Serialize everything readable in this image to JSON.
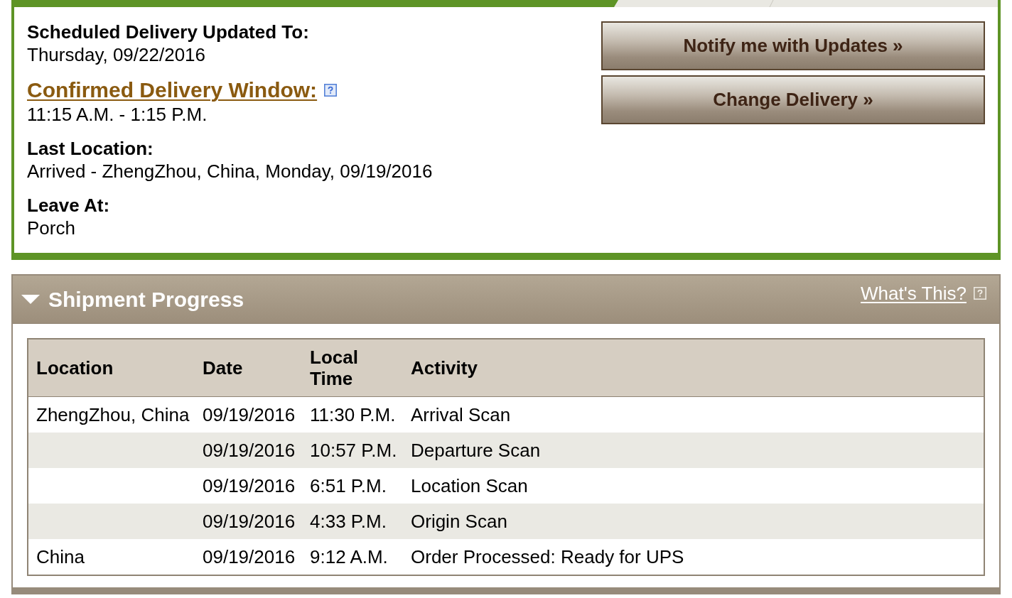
{
  "delivery_details": [
    {
      "kind": "label",
      "label": "Scheduled Delivery Updated To:",
      "value": "Thursday, 09/22/2016"
    },
    {
      "kind": "link",
      "label": "Confirmed Delivery Window:",
      "value": "11:15 A.M. - 1:15 P.M."
    },
    {
      "kind": "label",
      "label": "Last Location:",
      "value": "Arrived - ZhengZhou, China, Monday, 09/19/2016"
    },
    {
      "kind": "label",
      "label": "Leave At:",
      "value": "Porch"
    }
  ],
  "actions": [
    "Notify me with Updates »",
    "Change Delivery »"
  ],
  "shipment_progress": {
    "title": "Shipment Progress",
    "expanded": true,
    "help_link": "What's This?",
    "table": {
      "columns": [
        "Location",
        "Date",
        "Local Time",
        "Activity"
      ],
      "rows": [
        {
          "location": "ZhengZhou, China",
          "date": "09/19/2016",
          "local_time": "11:30 P.M.",
          "activity": "Arrival Scan"
        },
        {
          "date": "09/19/2016",
          "local_time": "10:57 P.M.",
          "activity": "Departure Scan"
        },
        {
          "date": "09/19/2016",
          "local_time": "6:51 P.M.",
          "activity": "Location Scan"
        },
        {
          "date": "09/19/2016",
          "local_time": "4:33 P.M.",
          "activity": "Origin Scan"
        },
        {
          "location": "China",
          "date": "09/19/2016",
          "local_time": "9:12 A.M.",
          "activity": "Order Processed: Ready for UPS"
        }
      ]
    }
  }
}
